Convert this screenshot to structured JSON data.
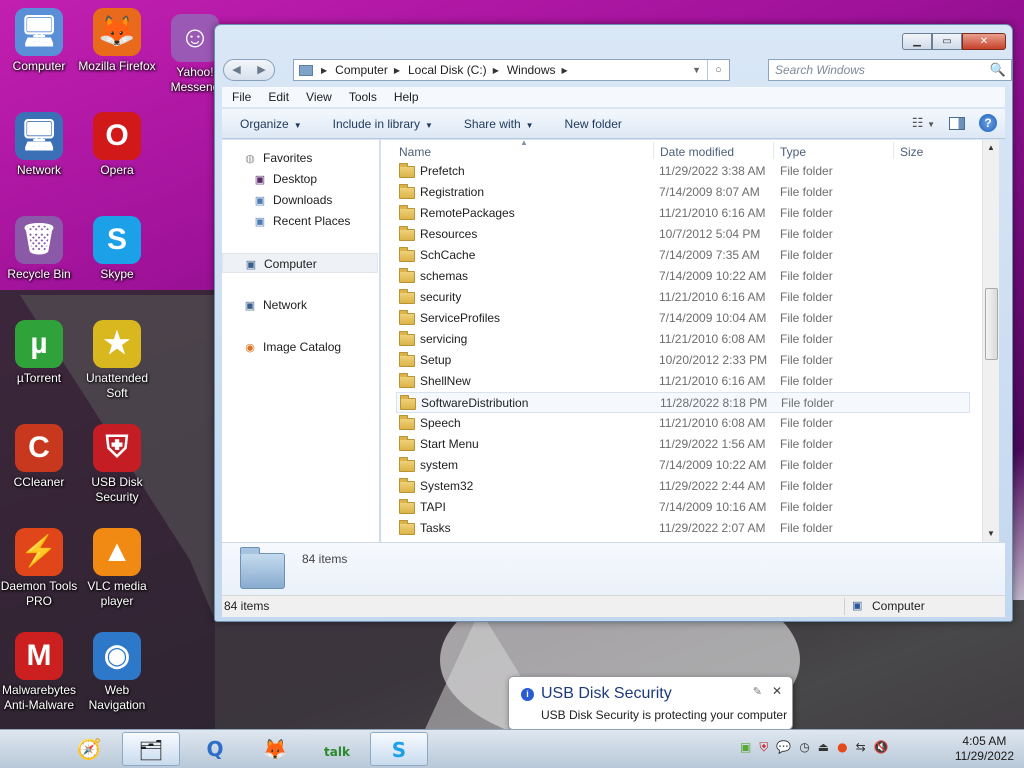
{
  "desktop": {
    "icons": [
      {
        "label": "Computer",
        "glyph": "🖥",
        "icon": "computer-icon",
        "bg": "#5a8fd8"
      },
      {
        "label": "Mozilla Firefox",
        "glyph": "🦊",
        "icon": "firefox-icon",
        "bg": "#e86a1a"
      },
      {
        "label": "Yahoo! Messeng",
        "glyph": "☺",
        "icon": "yahoo-messenger-icon",
        "bg": "#9b59b6"
      },
      {
        "label": "Network",
        "glyph": "🖥",
        "icon": "network-icon",
        "bg": "#3b6fb6"
      },
      {
        "label": "Opera",
        "glyph": "O",
        "icon": "opera-icon",
        "bg": "#d11919"
      },
      {
        "label": "Recycle Bin",
        "glyph": "🗑",
        "icon": "recycle-bin-icon",
        "bg": "#8a5aa8"
      },
      {
        "label": "Skype",
        "glyph": "S",
        "icon": "skype-icon",
        "bg": "#1ca0e8"
      },
      {
        "label": "µTorrent",
        "glyph": "µ",
        "icon": "utorrent-icon",
        "bg": "#2fa33a"
      },
      {
        "label": "Unattended Soft",
        "glyph": "★",
        "icon": "star-icon",
        "bg": "#d8b81e"
      },
      {
        "label": "CCleaner",
        "glyph": "C",
        "icon": "ccleaner-icon",
        "bg": "#c8381e"
      },
      {
        "label": "USB Disk Security",
        "glyph": "⛨",
        "icon": "shield-icon",
        "bg": "#c41e24"
      },
      {
        "label": "Daemon Tools PRO",
        "glyph": "⚡",
        "icon": "daemon-tools-icon",
        "bg": "#e0461a"
      },
      {
        "label": "VLC media player",
        "glyph": "▲",
        "icon": "vlc-icon",
        "bg": "#f08a12"
      },
      {
        "label": "Malwarebytes Anti-Malware",
        "glyph": "M",
        "icon": "malwarebytes-icon",
        "bg": "#cc2020"
      },
      {
        "label": "Web Navigation",
        "glyph": "◉",
        "icon": "globe-icon",
        "bg": "#2d78c8"
      }
    ]
  },
  "explorer": {
    "window_buttons": {
      "min": "▁",
      "max": "▭",
      "close": "✕"
    },
    "nav": {
      "back": "◀",
      "forward": "▶"
    },
    "address": {
      "crumbs": [
        "Computer",
        "Local Disk (C:)",
        "Windows"
      ]
    },
    "search": {
      "placeholder": "Search Windows"
    },
    "menu": [
      "File",
      "Edit",
      "View",
      "Tools",
      "Help"
    ],
    "toolbar": [
      "Organize",
      "Include in library",
      "Share with",
      "New folder"
    ],
    "toolbar_extra": "New folder",
    "nav_pane": {
      "favorites": "Favorites",
      "desktop": "Desktop",
      "downloads": "Downloads",
      "recent": "Recent Places",
      "computer": "Computer",
      "network": "Network",
      "image_catalog": "Image Catalog"
    },
    "columns": {
      "name": "Name",
      "date": "Date modified",
      "type": "Type",
      "size": "Size"
    },
    "files": [
      {
        "name": "Prefetch",
        "date": "11/29/2022 3:38 AM",
        "type": "File folder"
      },
      {
        "name": "Registration",
        "date": "7/14/2009 8:07 AM",
        "type": "File folder"
      },
      {
        "name": "RemotePackages",
        "date": "11/21/2010 6:16 AM",
        "type": "File folder"
      },
      {
        "name": "Resources",
        "date": "10/7/2012 5:04 PM",
        "type": "File folder"
      },
      {
        "name": "SchCache",
        "date": "7/14/2009 7:35 AM",
        "type": "File folder"
      },
      {
        "name": "schemas",
        "date": "7/14/2009 10:22 AM",
        "type": "File folder"
      },
      {
        "name": "security",
        "date": "11/21/2010 6:16 AM",
        "type": "File folder"
      },
      {
        "name": "ServiceProfiles",
        "date": "7/14/2009 10:04 AM",
        "type": "File folder"
      },
      {
        "name": "servicing",
        "date": "11/21/2010 6:08 AM",
        "type": "File folder"
      },
      {
        "name": "Setup",
        "date": "10/20/2012 2:33 PM",
        "type": "File folder"
      },
      {
        "name": "ShellNew",
        "date": "11/21/2010 6:16 AM",
        "type": "File folder"
      },
      {
        "name": "SoftwareDistribution",
        "date": "11/28/2022 8:18 PM",
        "type": "File folder",
        "hover": true
      },
      {
        "name": "Speech",
        "date": "11/21/2010 6:08 AM",
        "type": "File folder"
      },
      {
        "name": "Start Menu",
        "date": "11/29/2022 1:56 AM",
        "type": "File folder"
      },
      {
        "name": "system",
        "date": "7/14/2009 10:22 AM",
        "type": "File folder"
      },
      {
        "name": "System32",
        "date": "11/29/2022 2:44 AM",
        "type": "File folder"
      },
      {
        "name": "TAPI",
        "date": "7/14/2009 10:16 AM",
        "type": "File folder"
      },
      {
        "name": "Tasks",
        "date": "11/29/2022 2:07 AM",
        "type": "File folder"
      }
    ],
    "details_count": "84 items",
    "status": {
      "count": "84 items",
      "location": "Computer"
    }
  },
  "toast": {
    "title": "USB Disk Security",
    "body": "USB Disk Security is protecting your computer",
    "close": "✕"
  },
  "taskbar": {
    "apps": [
      {
        "icon": "apple-icon",
        "glyph": "",
        "active": false
      },
      {
        "icon": "safari-icon",
        "glyph": "🧭",
        "active": false
      },
      {
        "icon": "explorer-icon",
        "glyph": "🗂",
        "active": true
      },
      {
        "icon": "quicktime-icon",
        "glyph": "Q",
        "active": false
      },
      {
        "icon": "firefox-icon",
        "glyph": "🦊",
        "active": false
      },
      {
        "icon": "google-talk-icon",
        "glyph": "talk",
        "active": false
      },
      {
        "icon": "skype-icon",
        "glyph": "S",
        "active": true
      }
    ],
    "time": "4:05 AM",
    "date": "11/29/2022"
  }
}
